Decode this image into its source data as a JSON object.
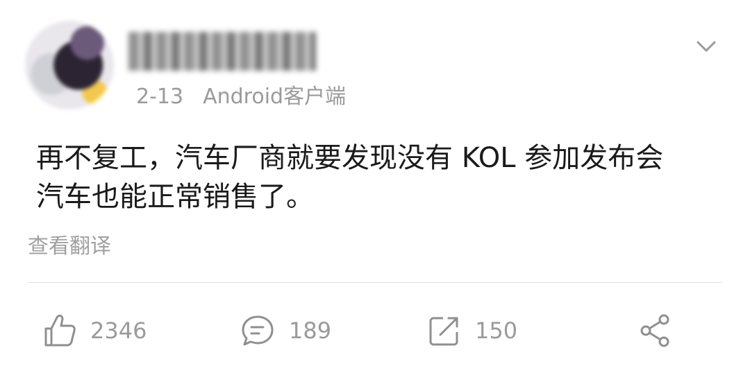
{
  "post": {
    "date": "2-13",
    "source": "Android客户端",
    "text_line1": "再不复工，汽车厂商就要发现没有 KOL 参加发布会",
    "text_line2": "汽车也能正常销售了。",
    "translate_label": "查看翻译"
  },
  "actions": {
    "like_count": "2346",
    "comment_count": "189",
    "repost_count": "150"
  },
  "icons": {
    "more": "chevron-down-icon",
    "like": "thumbs-up-icon",
    "comment": "comment-bubble-icon",
    "repost": "repost-arrow-icon",
    "share": "share-icon"
  },
  "colors": {
    "text": "#1a1a1a",
    "muted": "#9a9a9a",
    "divider": "#e3e3e3"
  }
}
